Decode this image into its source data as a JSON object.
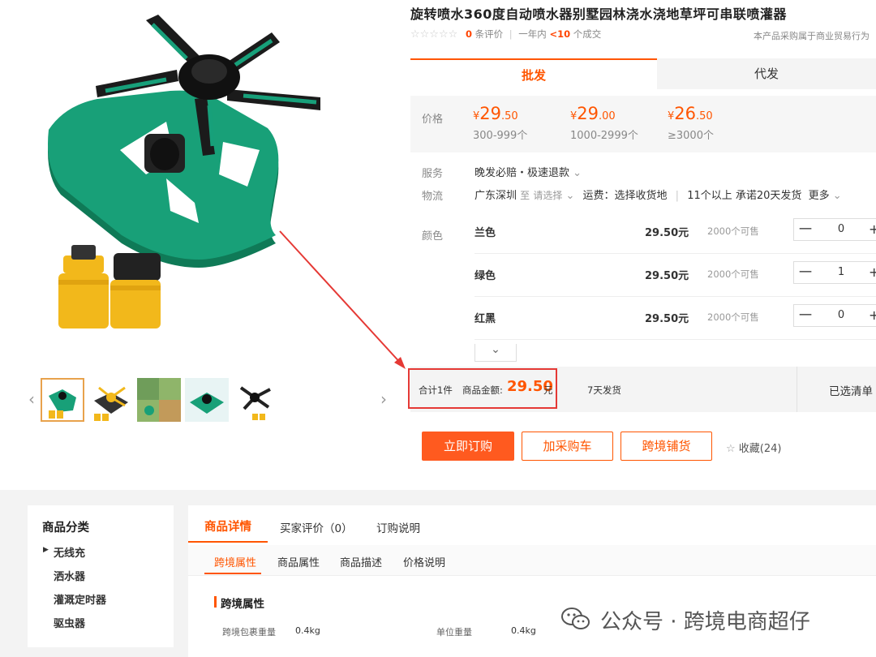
{
  "product": {
    "title": "旋转喷水360度自动喷水器别墅园林浇水浇地草坪可串联喷灌器",
    "review_count": "0",
    "review_suffix": "条评价",
    "period": "一年内",
    "deals": "<10",
    "deals_suffix": "个成交",
    "buyer_note": "本产品采购属于商业贸易行为"
  },
  "tabs": {
    "wholesale": "批发",
    "dropship": "代发"
  },
  "price": {
    "label": "价格",
    "tiers": [
      {
        "yen": "¥",
        "int": "29",
        "dec": ".50",
        "range": "300-999个"
      },
      {
        "yen": "¥",
        "int": "29",
        "dec": ".00",
        "range": "1000-2999个"
      },
      {
        "yen": "¥",
        "int": "26",
        "dec": ".50",
        "range": "≥3000个"
      }
    ]
  },
  "service": {
    "label": "服务",
    "value": "晚发必赔・极速退款",
    "chev": "⌄"
  },
  "logistics": {
    "label": "物流",
    "from": "广东深圳",
    "to": "至",
    "select": "请选择",
    "freight": "运费：选择收货地",
    "promise": "11个以上 承诺20天发货",
    "more": "更多"
  },
  "colors": {
    "label": "颜色",
    "items": [
      {
        "name": "兰色",
        "price": "29.50元",
        "stock": "2000个可售",
        "qty": "0",
        "minus": "一",
        "plus": "+"
      },
      {
        "name": "绿色",
        "price": "29.50元",
        "stock": "2000个可售",
        "qty": "1",
        "minus": "一",
        "plus": "+"
      },
      {
        "name": "红黑",
        "price": "29.50元",
        "stock": "2000个可售",
        "qty": "0",
        "minus": "一",
        "plus": "+"
      }
    ],
    "expand": "⌄"
  },
  "summary": {
    "total": "合计1件",
    "amount_label": "商品金额:",
    "amount": "29.50",
    "unit": "元",
    "ship": "7天发货",
    "selected": "已选清单"
  },
  "actions": {
    "buy": "立即订购",
    "cart": "加采购车",
    "distribute": "跨境铺货",
    "fav": "收藏(24)",
    "fav_icon": "☆"
  },
  "sidebar": {
    "title": "商品分类",
    "items": [
      "无线充",
      "洒水器",
      "灌溉定时器",
      "驱虫器"
    ],
    "marker": "▶"
  },
  "detail": {
    "tabs": [
      "商品详情",
      "买家评价（0）",
      "订购说明"
    ],
    "subtabs": [
      "跨境属性",
      "商品属性",
      "商品描述",
      "价格说明"
    ],
    "section_title": "跨境属性",
    "attrs": [
      {
        "k": "跨境包裹重量",
        "v": "0.4kg"
      },
      {
        "k": "单位重量",
        "v": "0.4kg"
      }
    ]
  },
  "watermark": "公众号 · 跨境电商超仔",
  "colors_theme": {
    "accent": "#ff5500",
    "highlight": "#e53935",
    "product_green": "#16936b",
    "yellow": "#f2b81b"
  }
}
